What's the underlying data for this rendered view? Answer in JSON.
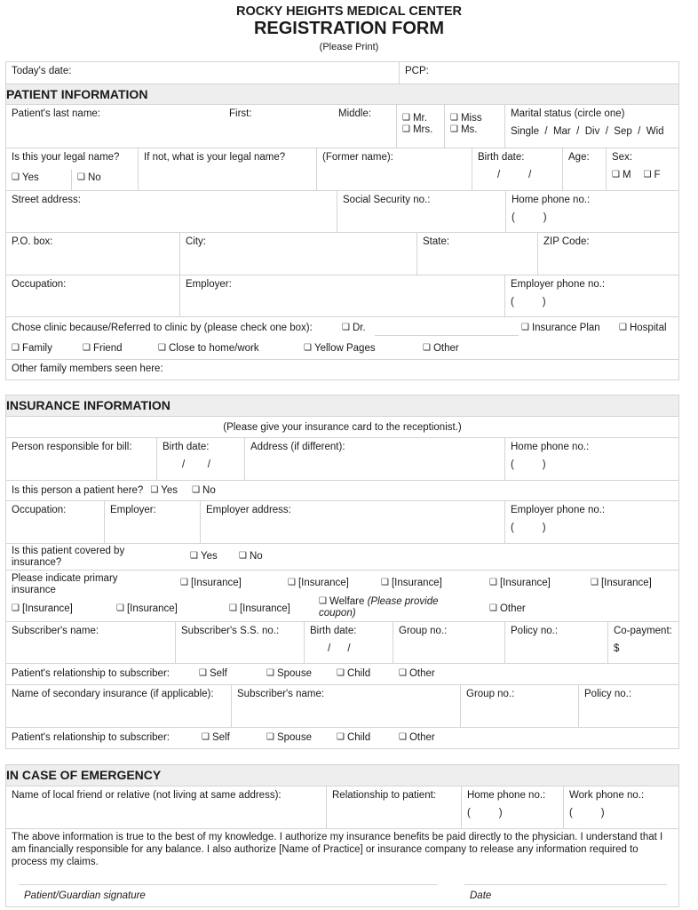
{
  "header": {
    "organization": "ROCKY HEIGHTS MEDICAL CENTER",
    "title": "REGISTRATION FORM",
    "subtitle": "(Please Print)"
  },
  "top": {
    "todays_date": "Today's date:",
    "pcp": "PCP:"
  },
  "patient": {
    "heading": "PATIENT INFORMATION",
    "last_name": "Patient's last name:",
    "first": "First:",
    "middle": "Middle:",
    "titles": [
      "Mr.",
      "Mrs.",
      "Miss",
      "Ms."
    ],
    "marital_label": "Marital status (circle one)",
    "marital_options": "Single  /  Mar  /  Div  /  Sep  /  Wid",
    "legal_name_q": "Is this your legal name?",
    "yes": "Yes",
    "no": "No",
    "if_not": "If not, what is your legal name?",
    "former_name": "(Former name):",
    "birth_date": "Birth date:",
    "date_slashes": "/          /",
    "age": "Age:",
    "sex": "Sex:",
    "sex_m": "M",
    "sex_f": "F",
    "street": "Street address:",
    "ssn": "Social Security no.:",
    "home_phone": "Home phone no.:",
    "phone_paren": "(          )",
    "po_box": "P.O. box:",
    "city": "City:",
    "state": "State:",
    "zip": "ZIP Code:",
    "occupation": "Occupation:",
    "employer": "Employer:",
    "employer_phone": "Employer phone no.:",
    "chose_clinic": "Chose clinic because/Referred to clinic by (please check one box):",
    "referral_options": [
      "Dr.",
      "Insurance Plan",
      "Hospital",
      "Family",
      "Friend",
      "Close to home/work",
      "Yellow Pages",
      "Other"
    ],
    "other_family": "Other family members seen here:"
  },
  "insurance": {
    "heading": "INSURANCE INFORMATION",
    "note": "(Please give your insurance card to the receptionist.)",
    "responsible": "Person responsible for bill:",
    "birth_date": "Birth date:",
    "date_slashes": "/        /",
    "address": "Address (if different):",
    "home_phone": "Home phone no.:",
    "phone_paren": "(          )",
    "is_patient_q": "Is this person a patient here?",
    "yes": "Yes",
    "no": "No",
    "occupation": "Occupation:",
    "employer": "Employer:",
    "employer_address": "Employer address:",
    "employer_phone": "Employer phone no.:",
    "covered_q": "Is this patient covered by insurance?",
    "primary_q": "Please indicate primary insurance",
    "insurance_options": [
      "[Insurance]",
      "[Insurance]",
      "[Insurance]",
      "[Insurance]",
      "[Insurance]",
      "[Insurance]",
      "[Insurance]",
      "[Insurance]"
    ],
    "welfare": "Welfare",
    "welfare_note": "(Please provide coupon)",
    "other": "Other",
    "subscriber_name": "Subscriber's name:",
    "subscriber_ssn": "Subscriber's S.S. no.:",
    "group_no": "Group no.:",
    "policy_no": "Policy no.:",
    "copayment": "Co-payment:",
    "dollar": "$",
    "relationship": "Patient's relationship to subscriber:",
    "relationship_options": [
      "Self",
      "Spouse",
      "Child",
      "Other"
    ],
    "secondary": "Name of secondary insurance (if applicable):"
  },
  "emergency": {
    "heading": "IN CASE OF EMERGENCY",
    "name": "Name of local friend or relative (not living at same address):",
    "relationship": "Relationship to patient:",
    "home_phone": "Home phone no.:",
    "work_phone": "Work phone no.:",
    "phone_paren": "(          )",
    "statement": "The above information is true to the best of my knowledge. I authorize my insurance benefits be paid directly to the physician. I understand that I am financially responsible for any balance. I also authorize [Name of Practice] or insurance company to release any information required to process my claims.",
    "signature": "Patient/Guardian signature",
    "date": "Date"
  }
}
